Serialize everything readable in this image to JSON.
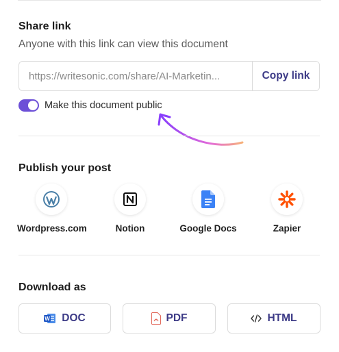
{
  "share": {
    "title": "Share link",
    "subtitle": "Anyone with this link can view this document",
    "link_value": "https://writesonic.com/share/AI-Marketin...",
    "copy_label": "Copy link",
    "public_toggle": {
      "label": "Make this document public",
      "on": true
    }
  },
  "publish": {
    "title": "Publish your post",
    "items": [
      {
        "label": "Wordpress.com",
        "icon": "wordpress-icon"
      },
      {
        "label": "Notion",
        "icon": "notion-icon"
      },
      {
        "label": "Google Docs",
        "icon": "google-docs-icon"
      },
      {
        "label": "Zapier",
        "icon": "zapier-icon"
      }
    ]
  },
  "download": {
    "title": "Download as",
    "buttons": [
      {
        "label": "DOC",
        "icon": "word-icon"
      },
      {
        "label": "PDF",
        "icon": "pdf-icon"
      },
      {
        "label": "HTML",
        "icon": "code-icon"
      }
    ]
  },
  "colors": {
    "accent": "#6c4fd7",
    "button_text": "#3c3a86",
    "arrow_start": "#f7a35c",
    "arrow_end": "#8a3ffc"
  }
}
